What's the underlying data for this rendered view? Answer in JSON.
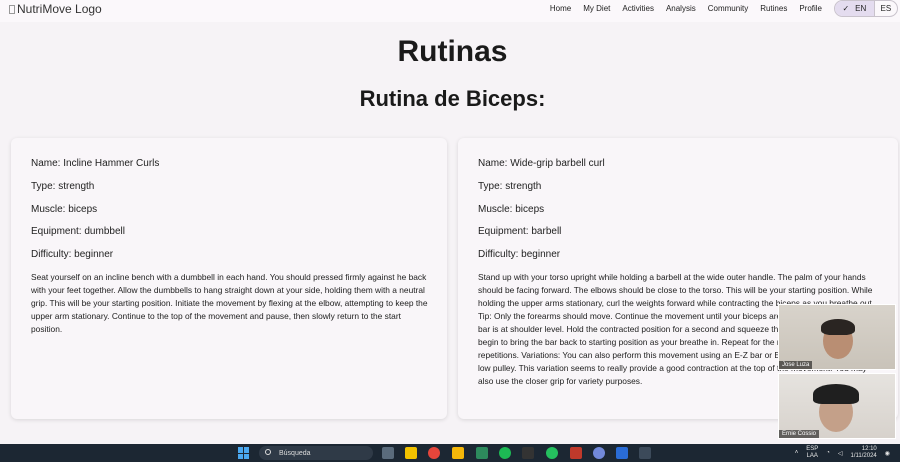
{
  "header": {
    "logo_alt": "NutriMove Logo",
    "nav": [
      "Home",
      "My Diet",
      "Activities",
      "Analysis",
      "Community",
      "Rutines",
      "Profile"
    ],
    "lang_options": [
      "EN",
      "ES"
    ],
    "lang_selected": "EN"
  },
  "page": {
    "title": "Rutinas",
    "subtitle": "Rutina de Biceps:"
  },
  "routines": [
    {
      "name": "Name: Incline Hammer Curls",
      "type": "Type: strength",
      "muscle": "Muscle: biceps",
      "equipment": "Equipment: dumbbell",
      "difficulty": "Difficulty: beginner",
      "description": "Seat yourself on an incline bench with a dumbbell in each hand. You should pressed firmly against he back with your feet together. Allow the dumbbells to hang straight down at your side, holding them with a neutral grip. This will be your starting position. Initiate the movement by flexing at the elbow, attempting to keep the upper arm stationary. Continue to the top of the movement and pause, then slowly return to the start position."
    },
    {
      "name": "Name: Wide-grip barbell curl",
      "type": "Type: strength",
      "muscle": "Muscle: biceps",
      "equipment": "Equipment: barbell",
      "difficulty": "Difficulty: beginner",
      "description": "Stand up with your torso upright while holding a barbell at the wide outer handle. The palm of your hands should be facing forward. The elbows should be close to the torso. This will be your starting position. While holding the upper arms stationary, curl the weights forward while contracting the biceps as you breathe out. Tip: Only the forearms should move. Continue the movement until your biceps are fully contracted and the bar is at shoulder level. Hold the contracted position for a second and squeeze the biceps hard. Slowly begin to bring the bar back to starting position as your breathe in. Repeat for the recommended amount of repetitions. Variations: You can also perform this movement using an E-Z bar or E-Z attachment hooked to a low pulley. This variation seems to really provide a good contraction at the top of the movement. You may also use the closer grip for variety purposes."
    }
  ],
  "taskbar": {
    "search_placeholder": "Búsqueda",
    "lang_top": "ESP",
    "lang_bottom": "LAA",
    "time": "12:10",
    "date": "1/11/2024"
  },
  "video_call": {
    "participants": [
      "Jose Luza",
      "Ernie Cossio"
    ]
  }
}
